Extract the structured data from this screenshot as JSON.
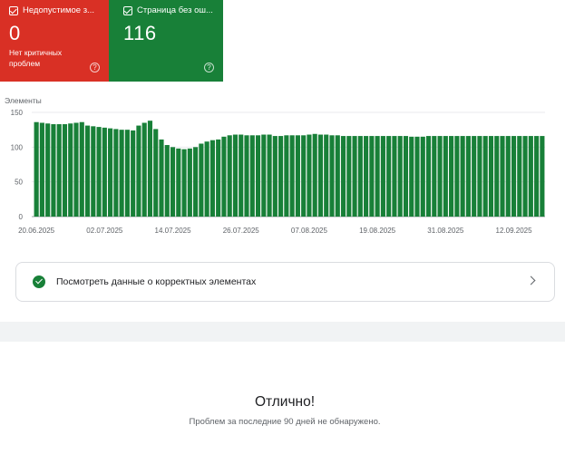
{
  "tiles": {
    "invalid": {
      "label": "Недопустимое з...",
      "count": "0",
      "sub": "Нет критичных проблем",
      "color": "#d93025"
    },
    "valid": {
      "label": "Страница без ош...",
      "count": "116",
      "color": "#188038"
    }
  },
  "chart_data": {
    "type": "bar",
    "ylabel": "Элементы",
    "ylim": [
      0,
      150
    ],
    "yticks": [
      0,
      50,
      100,
      150
    ],
    "grid": true,
    "color": "#188038",
    "xtick_labels": [
      "20.06.2025",
      "02.07.2025",
      "14.07.2025",
      "26.07.2025",
      "07.08.2025",
      "19.08.2025",
      "31.08.2025",
      "12.09.2025"
    ],
    "values": [
      136,
      135,
      134,
      133,
      133,
      133,
      134,
      135,
      136,
      131,
      130,
      129,
      128,
      127,
      126,
      125,
      125,
      124,
      131,
      135,
      138,
      126,
      111,
      103,
      100,
      98,
      97,
      98,
      100,
      105,
      108,
      110,
      111,
      115,
      117,
      118,
      118,
      117,
      117,
      117,
      118,
      118,
      116,
      116,
      117,
      117,
      117,
      117,
      118,
      119,
      118,
      118,
      117,
      117,
      116,
      116,
      116,
      116,
      116,
      116,
      116,
      116,
      116,
      116,
      116,
      116,
      115,
      115,
      115,
      116,
      116,
      116,
      116,
      116,
      116,
      116,
      116,
      116,
      116,
      116,
      116,
      116,
      116,
      116,
      116,
      116,
      116,
      116,
      116,
      116
    ]
  },
  "link_card": {
    "label": "Посмотреть данные о корректных элементах"
  },
  "status": {
    "title": "Отлично!",
    "subtitle": "Проблем за последние 90 дней не обнаружено."
  }
}
